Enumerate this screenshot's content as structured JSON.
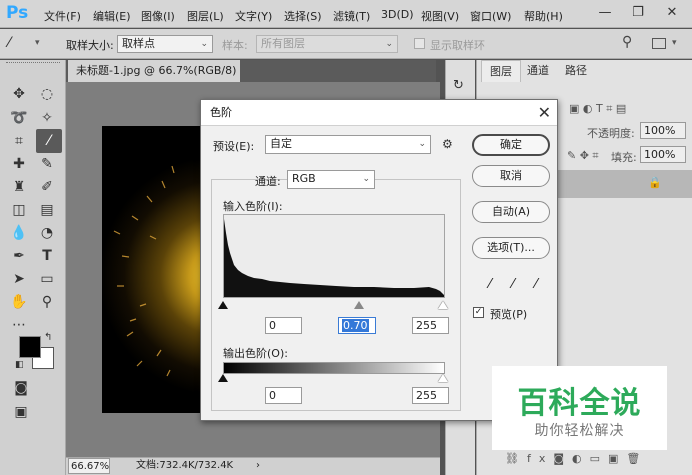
{
  "app": {
    "logo": "Ps",
    "menu": [
      "文件(F)",
      "编辑(E)",
      "图像(I)",
      "图层(L)",
      "文字(Y)",
      "选择(S)",
      "滤镜(T)",
      "3D(D)",
      "视图(V)",
      "窗口(W)",
      "帮助(H)"
    ],
    "window_buttons": [
      "—",
      "❐",
      "✕"
    ]
  },
  "options": {
    "sample_size_label": "取样大小:",
    "sample_size_value": "取样点",
    "sample_label": "样本:",
    "sample_value": "所有图层",
    "show_ring_label": "显示取样环"
  },
  "document": {
    "tab_title": "未标题-1.jpg @ 66.7%(RGB/8) *",
    "tab_close": "×",
    "zoom": "66.67%",
    "doc_info": "文档:732.4K/732.4K"
  },
  "panels": {
    "tabs": [
      "图层",
      "通道",
      "路径"
    ],
    "opacity_label": "不透明度:",
    "opacity_value": "100%",
    "fill_label": "填充:",
    "fill_value": "100%"
  },
  "dialog": {
    "title": "色阶",
    "close": "✕",
    "preset_label": "预设(E):",
    "preset_value": "自定",
    "channel_label": "通道:",
    "channel_value": "RGB",
    "input_label": "输入色阶(I):",
    "input_black": "0",
    "input_gamma": "0.70",
    "input_white": "255",
    "output_label": "输出色阶(O):",
    "output_black": "0",
    "output_white": "255",
    "buttons": {
      "ok": "确定",
      "cancel": "取消",
      "auto": "自动(A)",
      "options": "选项(T)..."
    },
    "preview_label": "预览(P)",
    "preview_checked": "✓"
  },
  "watermark": {
    "title": "百科全说",
    "subtitle": "助你轻松解决"
  },
  "colors": {
    "accent_blue": "#31a8ff",
    "selection": "#3478d8",
    "watermark_green": "#2daa5a"
  }
}
